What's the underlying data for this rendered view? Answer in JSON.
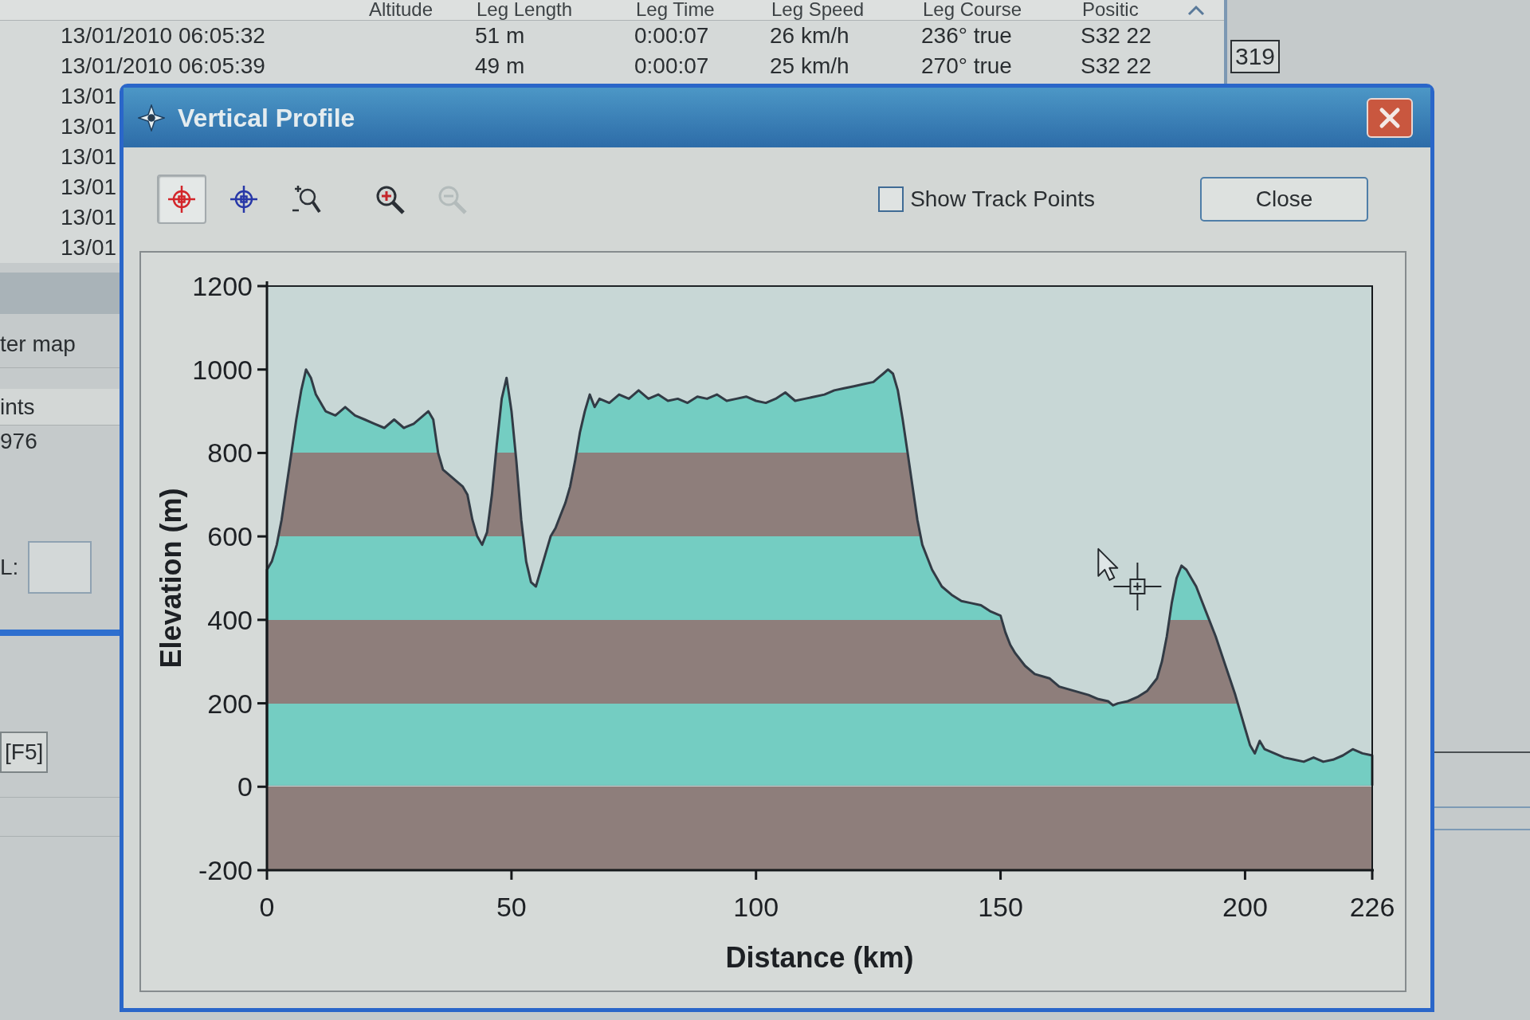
{
  "background_window": {
    "track_table": {
      "columns": [
        "Altitude",
        "Leg Length",
        "Leg Time",
        "Leg Speed",
        "Leg Course",
        "Positic"
      ],
      "rows": [
        {
          "time": "13/01/2010 06:05:32",
          "leg_length": "51 m",
          "leg_time": "0:00:07",
          "leg_speed": "26 km/h",
          "leg_course": "236° true",
          "position": "S32 22"
        },
        {
          "time": "13/01/2010 06:05:39",
          "leg_length": "49 m",
          "leg_time": "0:00:07",
          "leg_speed": "25 km/h",
          "leg_course": "270° true",
          "position": "S32 22"
        },
        {
          "time": "13/01"
        },
        {
          "time": "13/01"
        },
        {
          "time": "13/01"
        },
        {
          "time": "13/01"
        },
        {
          "time": "13/01"
        },
        {
          "time": "13/01"
        }
      ]
    },
    "number_box": "319",
    "side_panel": {
      "caption": "ter map",
      "list_header": "ints",
      "list_value": "976",
      "field_label": "L:",
      "button": "[F5]"
    }
  },
  "dialog": {
    "title": "Vertical Profile",
    "tool_groups": [
      {
        "tools": [
          {
            "kind": "crosshair",
            "color": "#d3262b",
            "selected": true,
            "disabled": false
          },
          {
            "kind": "crosshair",
            "color": "#2838a8",
            "selected": false,
            "disabled": false
          },
          {
            "kind": "zoom_area",
            "selected": false,
            "disabled": false
          }
        ]
      },
      {
        "tools": [
          {
            "kind": "zoom_in",
            "selected": false,
            "disabled": false
          },
          {
            "kind": "zoom_out",
            "selected": false,
            "disabled": true
          }
        ]
      }
    ],
    "show_track_points": {
      "label": "Show Track Points",
      "checked": false
    },
    "close_button": "Close",
    "chart_data": {
      "type": "area",
      "xlabel": "Distance (km)",
      "ylabel": "Elevation (m)",
      "x": [
        0,
        1,
        2,
        3,
        4,
        5,
        6,
        7,
        8,
        9,
        10,
        11,
        12,
        14,
        16,
        18,
        20,
        22,
        24,
        26,
        28,
        30,
        32,
        33,
        34,
        35,
        36,
        37,
        38,
        39,
        40,
        41,
        42,
        43,
        44,
        45,
        46,
        47,
        48,
        49,
        50,
        51,
        52,
        53,
        54,
        55,
        56,
        57,
        58,
        59,
        60,
        61,
        62,
        63,
        64,
        65,
        66,
        67,
        68,
        70,
        72,
        74,
        76,
        78,
        80,
        82,
        84,
        86,
        88,
        90,
        92,
        94,
        96,
        98,
        100,
        102,
        104,
        106,
        108,
        110,
        112,
        114,
        116,
        118,
        120,
        122,
        124,
        125,
        126,
        127,
        128,
        129,
        130,
        131,
        132,
        133,
        134,
        135,
        136,
        137,
        138,
        140,
        142,
        144,
        146,
        148,
        150,
        151,
        152,
        153,
        155,
        157,
        160,
        162,
        165,
        168,
        170,
        172,
        173,
        174,
        176,
        178,
        180,
        182,
        183,
        184,
        185,
        186,
        187,
        188,
        189,
        190,
        191,
        192,
        194,
        196,
        198,
        200,
        201,
        202,
        203,
        204,
        206,
        208,
        210,
        212,
        214,
        216,
        218,
        220,
        222,
        224,
        226
      ],
      "values": [
        520,
        540,
        580,
        640,
        720,
        800,
        880,
        950,
        1000,
        980,
        940,
        920,
        900,
        890,
        910,
        890,
        880,
        870,
        860,
        880,
        860,
        870,
        890,
        900,
        880,
        800,
        760,
        750,
        740,
        730,
        720,
        700,
        640,
        600,
        580,
        610,
        700,
        820,
        930,
        980,
        900,
        780,
        640,
        540,
        490,
        480,
        520,
        560,
        600,
        620,
        650,
        680,
        720,
        780,
        850,
        900,
        940,
        910,
        930,
        920,
        940,
        930,
        950,
        930,
        940,
        925,
        930,
        920,
        935,
        930,
        940,
        925,
        930,
        935,
        925,
        920,
        930,
        945,
        925,
        930,
        935,
        940,
        950,
        955,
        960,
        965,
        970,
        980,
        990,
        1000,
        990,
        950,
        880,
        800,
        720,
        640,
        580,
        550,
        520,
        500,
        480,
        460,
        445,
        440,
        435,
        420,
        410,
        370,
        340,
        320,
        290,
        270,
        260,
        240,
        230,
        220,
        210,
        205,
        195,
        200,
        205,
        215,
        230,
        260,
        300,
        360,
        440,
        500,
        530,
        520,
        500,
        480,
        450,
        420,
        360,
        290,
        220,
        140,
        100,
        80,
        110,
        90,
        80,
        70,
        65,
        60,
        70,
        60,
        65,
        75,
        90,
        80,
        75
      ],
      "xlim": [
        0,
        226
      ],
      "ylim": [
        -200,
        1200
      ],
      "xticks": [
        0,
        50,
        100,
        150,
        200,
        226
      ],
      "yticks": [
        -200,
        0,
        200,
        400,
        600,
        800,
        1000,
        1200
      ]
    }
  }
}
